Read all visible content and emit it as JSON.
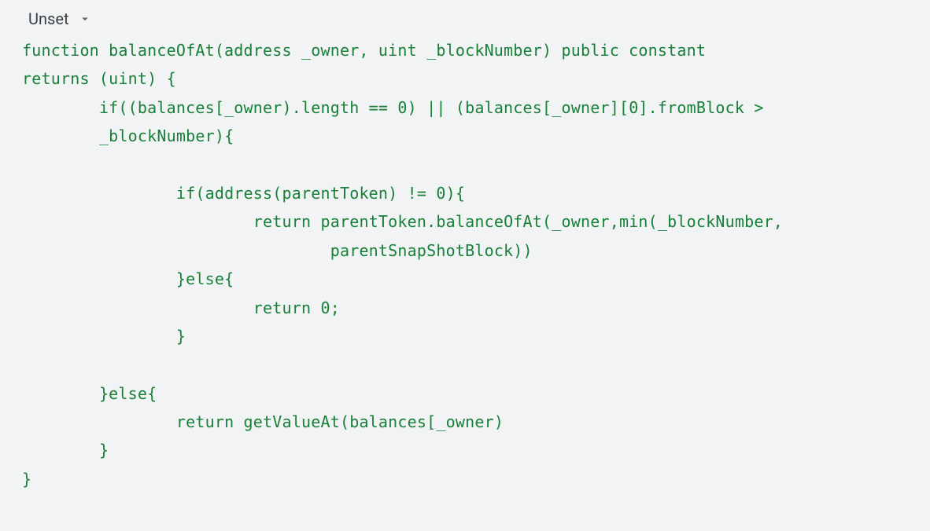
{
  "header": {
    "language_label": "Unset"
  },
  "code": {
    "lines": [
      "function balanceOfAt(address _owner, uint _blockNumber) public constant",
      "returns (uint) {",
      "        if((balances[_owner).length == 0) || (balances[_owner][0].fromBlock >",
      "        _blockNumber){",
      "",
      "                if(address(parentToken) != 0){",
      "                        return parentToken.balanceOfAt(_owner,min(_blockNumber,",
      "                                parentSnapShotBlock))",
      "                }else{",
      "                        return 0;",
      "                }",
      "",
      "        }else{",
      "                return getValueAt(balances[_owner)",
      "        }",
      "}"
    ]
  }
}
